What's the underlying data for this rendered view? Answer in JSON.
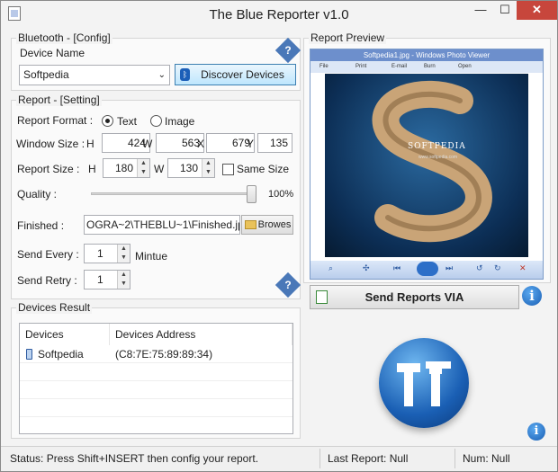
{
  "window": {
    "title": "The Blue Reporter v1.0",
    "minimize_glyph": "—",
    "maximize_glyph": "☐",
    "close_glyph": "✕"
  },
  "bluetooth": {
    "group_label": "Bluetooth - [Config]",
    "device_name_label": "Device Name",
    "device_name_value": "Softpedia",
    "discover_button": "Discover Devices",
    "help_glyph": "?"
  },
  "report": {
    "group_label": "Report - [Setting]",
    "format_label": "Report Format :",
    "format_options": [
      "Text",
      "Image"
    ],
    "format_selected": "Text",
    "window_size_label": "Window Size :",
    "ws_h_label": "H",
    "ws_h": "424",
    "ws_w_label": "W",
    "ws_w": "563",
    "ws_x_label": "X",
    "ws_x": "679",
    "ws_y_label": "Y",
    "ws_y": "135",
    "report_size_label": "Report Size :",
    "rs_h_label": "H",
    "rs_h": "180",
    "rs_w_label": "W",
    "rs_w": "130",
    "same_size_label": "Same Size",
    "quality_label": "Quality :",
    "quality_value": "100%",
    "quality_fraction": 1.0,
    "finished_label": "Finished :",
    "finished_path": "OGRA~2\\THEBLU~1\\Finished.jpg",
    "browse_button": "Browes",
    "send_every_label": "Send Every :",
    "send_every_value": "1",
    "send_every_unit": "Mintue",
    "send_retry_label": "Send Retry :",
    "send_retry_value": "1",
    "help_glyph": "?"
  },
  "devices": {
    "group_label": "Devices Result",
    "columns": [
      "Devices",
      "Devices Address"
    ],
    "rows": [
      {
        "device": "Softpedia",
        "address": "(C8:7E:75:89:89:34)"
      }
    ]
  },
  "preview": {
    "group_label": "Report Preview",
    "viewer_title": "Softpedia1.jpg - Windows Photo Viewer",
    "viewer_menu": [
      "File",
      "Print",
      "E-mail",
      "Burn",
      "Open"
    ],
    "image_caption": "SOFTPEDIA",
    "image_sub": "www.softpedia.com"
  },
  "actions": {
    "send_reports_button": "Send Reports VIA",
    "info_glyph": "i"
  },
  "status": {
    "text": "Status: Press Shift+INSERT then config your report.",
    "last_report": "Last Report: Null",
    "num": "Num: Null"
  },
  "colors": {
    "accent_blue": "#1a5fb4",
    "close_red": "#c7463c"
  }
}
